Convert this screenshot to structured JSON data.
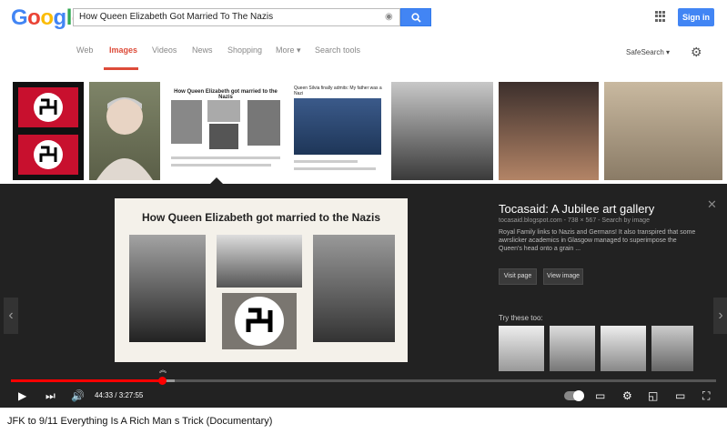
{
  "google": {
    "logo": [
      "G",
      "o",
      "o",
      "g",
      "l",
      "e"
    ],
    "search_query": "How Queen Elizabeth Got Married To The Nazis",
    "signin_label": "Sign in",
    "tabs": [
      {
        "label": "Web",
        "active": false
      },
      {
        "label": "Images",
        "active": true
      },
      {
        "label": "Videos",
        "active": false
      },
      {
        "label": "News",
        "active": false
      },
      {
        "label": "Shopping",
        "active": false
      },
      {
        "label": "More ▾",
        "active": false
      },
      {
        "label": "Search tools",
        "active": false
      }
    ],
    "safesearch_label": "SafeSearch ▾"
  },
  "results": {
    "thumb3_title": "How Queen Elizabeth got married to the Nazis",
    "thumb4_title": "Queen Silvia finally admits: My father was a Nazi"
  },
  "preview": {
    "title": "How Queen Elizabeth got married to the Nazis",
    "info_title": "Tocasaid: A Jubilee art gallery",
    "info_source": "tocasaid.blogspot.com - 738 × 567 - Search by image",
    "info_desc": "Royal Family links to Nazis and Germans! It also transpired that some awrslicker academics in Glasgow managed to superimpose the Queen's head onto a grain ...",
    "visit_label": "Visit page",
    "view_label": "View image",
    "try_label": "Try these too:"
  },
  "player": {
    "time": "44:33 / 3:27:55",
    "progress_fraction": 0.214,
    "video_title": "JFK to 9/11 Everything Is A Rich Man s Trick (Documentary)"
  }
}
